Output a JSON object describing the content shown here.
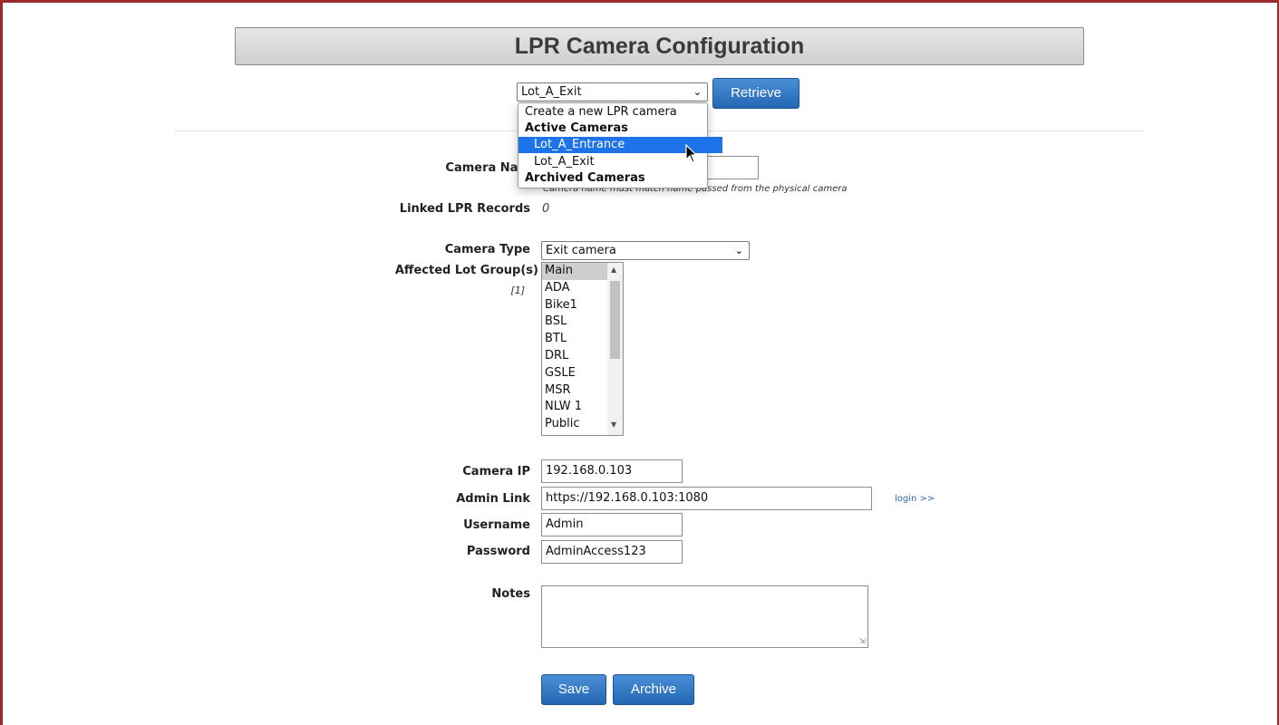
{
  "header": {
    "title": "LPR Camera Configuration"
  },
  "camera_selector": {
    "selected": "Lot_A_Exit",
    "retrieve_label": "Retrieve",
    "dropdown": {
      "create_option": "Create a new LPR camera",
      "active_group": "Active Cameras",
      "active_items": [
        "Lot_A_Entrance",
        "Lot_A_Exit"
      ],
      "highlighted": "Lot_A_Entrance",
      "archived_group": "Archived Cameras"
    }
  },
  "form": {
    "camera_name": {
      "label": "Camera Nam",
      "value": "",
      "note": "Camera name must match name passed from the physical camera"
    },
    "linked_records": {
      "label": "Linked LPR Records",
      "value": "0"
    },
    "camera_type": {
      "label": "Camera Type",
      "value": "Exit camera"
    },
    "lot_groups": {
      "label": "Affected Lot Group(s)",
      "count": "[1]",
      "options": [
        "Main",
        "ADA",
        "Bike1",
        "BSL",
        "BTL",
        "DRL",
        "GSLE",
        "MSR",
        "NLW 1",
        "Public"
      ],
      "selected": "Main"
    },
    "camera_ip": {
      "label": "Camera IP",
      "value": "192.168.0.103"
    },
    "admin_link": {
      "label": "Admin Link",
      "value": "https://192.168.0.103:1080",
      "login_link": "login >>"
    },
    "username": {
      "label": "Username",
      "value": "Admin"
    },
    "password": {
      "label": "Password",
      "value": "AdminAccess123"
    },
    "notes": {
      "label": "Notes",
      "value": ""
    }
  },
  "actions": {
    "save_label": "Save",
    "archive_label": "Archive"
  },
  "colors": {
    "frame": "#9b2b2b",
    "button": "#2f74c0",
    "highlight": "#1e73e8",
    "link": "#2b6cb0"
  },
  "icons": [
    "chevron-down-icon",
    "mouse-pointer-icon",
    "resize-grip-icon",
    "scroll-up-icon",
    "scroll-down-icon"
  ]
}
